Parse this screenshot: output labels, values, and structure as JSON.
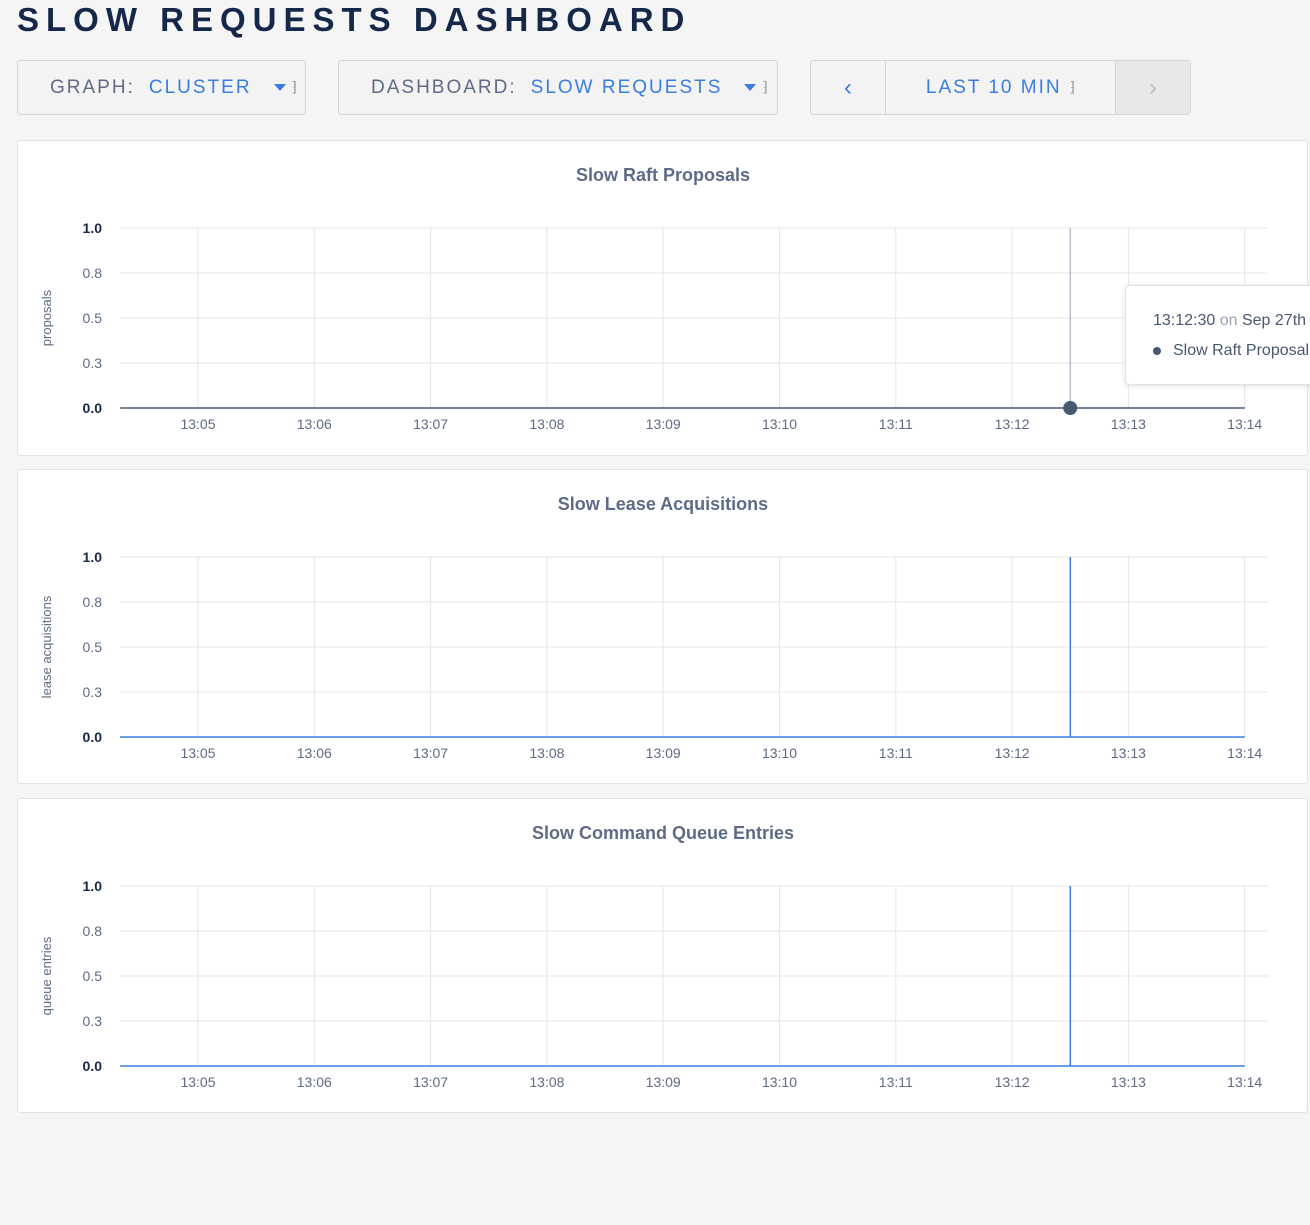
{
  "page": {
    "title": "SLOW REQUESTS DASHBOARD"
  },
  "controls": {
    "graph": {
      "label": "GRAPH:",
      "value": "CLUSTER"
    },
    "dashboard": {
      "label": "DASHBOARD:",
      "value": "SLOW REQUESTS"
    },
    "timerange": {
      "prev_icon": "chevron-left-icon",
      "label": "LAST 10 MIN",
      "next_icon": "chevron-right-icon"
    }
  },
  "tooltip": {
    "time": "13:12:30",
    "on": "on",
    "date": "Sep 27th",
    "series": "Slow Raft Proposals"
  },
  "colors": {
    "accent": "#3a7de1",
    "axis": "#475872",
    "grid": "#e6e6e6",
    "title": "#5d6b86"
  },
  "chart_data": [
    {
      "type": "line",
      "title": "Slow Raft Proposals",
      "ylabel": "proposals",
      "xlabel": "",
      "x_ticks": [
        "13:05",
        "13:06",
        "13:07",
        "13:08",
        "13:09",
        "13:10",
        "13:11",
        "13:12",
        "13:13",
        "13:14"
      ],
      "y_ticks": [
        "0.0",
        "0.3",
        "0.5",
        "0.8",
        "1.0"
      ],
      "ylim": [
        0,
        1
      ],
      "grid": true,
      "series": [
        {
          "name": "Slow Raft Proposals",
          "x": [
            "13:04:20",
            "13:14"
          ],
          "values": [
            0,
            0
          ]
        }
      ],
      "hover": {
        "time": "13:12:30",
        "value": 0
      }
    },
    {
      "type": "line",
      "title": "Slow Lease Acquisitions",
      "ylabel": "lease acquisitions",
      "xlabel": "",
      "x_ticks": [
        "13:05",
        "13:06",
        "13:07",
        "13:08",
        "13:09",
        "13:10",
        "13:11",
        "13:12",
        "13:13",
        "13:14"
      ],
      "y_ticks": [
        "0.0",
        "0.3",
        "0.5",
        "0.8",
        "1.0"
      ],
      "ylim": [
        0,
        1
      ],
      "grid": true,
      "series": [
        {
          "x": [
            "13:04:20",
            "13:12:30",
            "13:12:30",
            "13:12:30",
            "13:14"
          ],
          "values": [
            0,
            0,
            1,
            0,
            0
          ]
        }
      ]
    },
    {
      "type": "line",
      "title": "Slow Command Queue Entries",
      "ylabel": "queue entries",
      "xlabel": "",
      "x_ticks": [
        "13:05",
        "13:06",
        "13:07",
        "13:08",
        "13:09",
        "13:10",
        "13:11",
        "13:12",
        "13:13",
        "13:14"
      ],
      "y_ticks": [
        "0.0",
        "0.3",
        "0.5",
        "0.8",
        "1.0"
      ],
      "ylim": [
        0,
        1
      ],
      "grid": true,
      "series": [
        {
          "x": [
            "13:04:20",
            "13:12:30",
            "13:12:30",
            "13:12:30",
            "13:14"
          ],
          "values": [
            0,
            0,
            1,
            0,
            0
          ]
        }
      ]
    }
  ]
}
